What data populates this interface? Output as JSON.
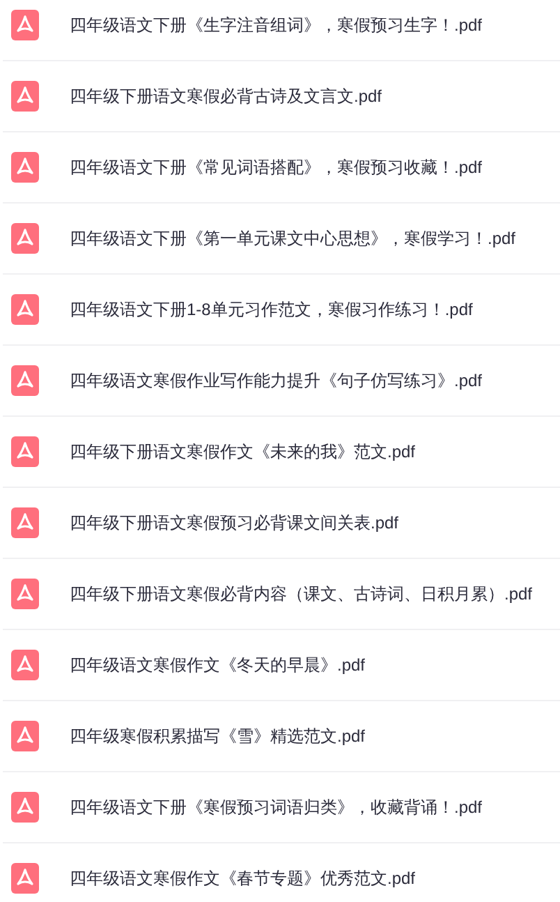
{
  "files": [
    {
      "name": "四年级语文下册《生字注音组词》，寒假预习生字！.pdf"
    },
    {
      "name": "四年级下册语文寒假必背古诗及文言文.pdf"
    },
    {
      "name": "四年级语文下册《常见词语搭配》，寒假预习收藏！.pdf"
    },
    {
      "name": "四年级语文下册《第一单元课文中心思想》，寒假学习！.pdf"
    },
    {
      "name": "四年级语文下册1-8单元习作范文，寒假习作练习！.pdf"
    },
    {
      "name": "四年级语文寒假作业写作能力提升《句子仿写练习》.pdf"
    },
    {
      "name": "四年级下册语文寒假作文《未来的我》范文.pdf"
    },
    {
      "name": "四年级下册语文寒假预习必背课文间关表.pdf"
    },
    {
      "name": "四年级下册语文寒假必背内容（课文、古诗词、日积月累）.pdf"
    },
    {
      "name": "四年级语文寒假作文《冬天的早晨》.pdf"
    },
    {
      "name": "四年级寒假积累描写《雪》精选范文.pdf"
    },
    {
      "name": "四年级语文下册《寒假预习词语归类》，收藏背诵！.pdf"
    },
    {
      "name": "四年级语文寒假作文《春节专题》优秀范文.pdf"
    }
  ]
}
